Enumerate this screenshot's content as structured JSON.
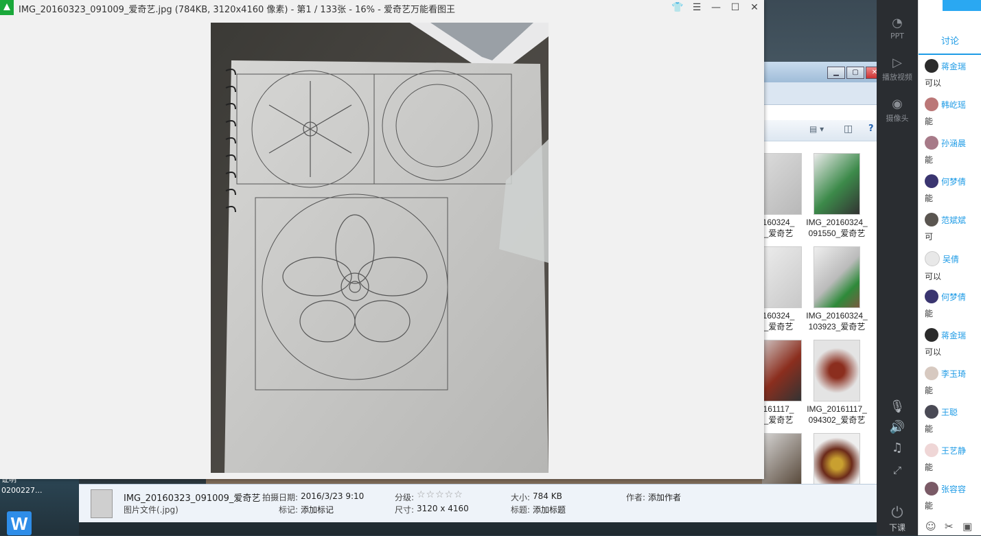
{
  "viewer": {
    "title": "IMG_20160323_091009_爱奇艺.jpg (784KB, 3120x4160 像素) - 第1 / 133张 - 16% - 爱奇艺万能看图王",
    "controls": [
      "skin",
      "menu",
      "minimize",
      "maximize",
      "close"
    ]
  },
  "desktop": {
    "left_texts": [
      "证明",
      "0200227..."
    ],
    "wps_label": "W"
  },
  "explorer": {
    "thumbs": [
      {
        "caption_1": "160324_",
        "caption_2": "_爱奇艺"
      },
      {
        "caption_1": "IMG_20160324_",
        "caption_2": "091550_爱奇艺"
      },
      {
        "caption_1": "160324_",
        "caption_2": "_爱奇艺"
      },
      {
        "caption_1": "IMG_20160324_",
        "caption_2": "103923_爱奇艺"
      },
      {
        "caption_1": "161117_",
        "caption_2": "_爱奇艺"
      },
      {
        "caption_1": "IMG_20161117_",
        "caption_2": "094302_爱奇艺"
      }
    ]
  },
  "infobar": {
    "filename": "IMG_20160323_091009_爱奇艺",
    "filetype": "图片文件(.jpg)",
    "date_label": "拍摄日期:",
    "date_value": "2016/3/23 9:10",
    "tag_label": "标记:",
    "tag_value": "添加标记",
    "rating_label": "分级:",
    "rating_stars": "☆☆☆☆☆",
    "dim_label": "尺寸:",
    "dim_value": "3120 x 4160",
    "size_label": "大小:",
    "size_value": "784 KB",
    "title_label": "标题:",
    "title_value": "添加标题",
    "author_label": "作者:",
    "author_value": "添加作者"
  },
  "rail": {
    "ppt": "PPT",
    "video": "播放视频",
    "camera": "摄像头",
    "end_class": "下课"
  },
  "discussion": {
    "tab": "讨论",
    "messages": [
      {
        "name": "蒋金瑞",
        "text": "可以"
      },
      {
        "name": "韩屹瑶",
        "text": "能"
      },
      {
        "name": "孙涵晨",
        "text": "能"
      },
      {
        "name": "何梦倩",
        "text": "能"
      },
      {
        "name": "范斌斌",
        "text": "可"
      },
      {
        "name": "吴倩",
        "text": "可以"
      },
      {
        "name": "何梦倩",
        "text": "能"
      },
      {
        "name": "蒋金瑞",
        "text": "可以"
      },
      {
        "name": "李玉琦",
        "text": "能"
      },
      {
        "name": "王聪",
        "text": "能"
      },
      {
        "name": "王艺静",
        "text": "能"
      },
      {
        "name": "张容容",
        "text": "能"
      }
    ]
  },
  "colors": {
    "accent": "#1e9be6",
    "app_icon": "#1aa83a",
    "rail": "#2a2d31"
  }
}
